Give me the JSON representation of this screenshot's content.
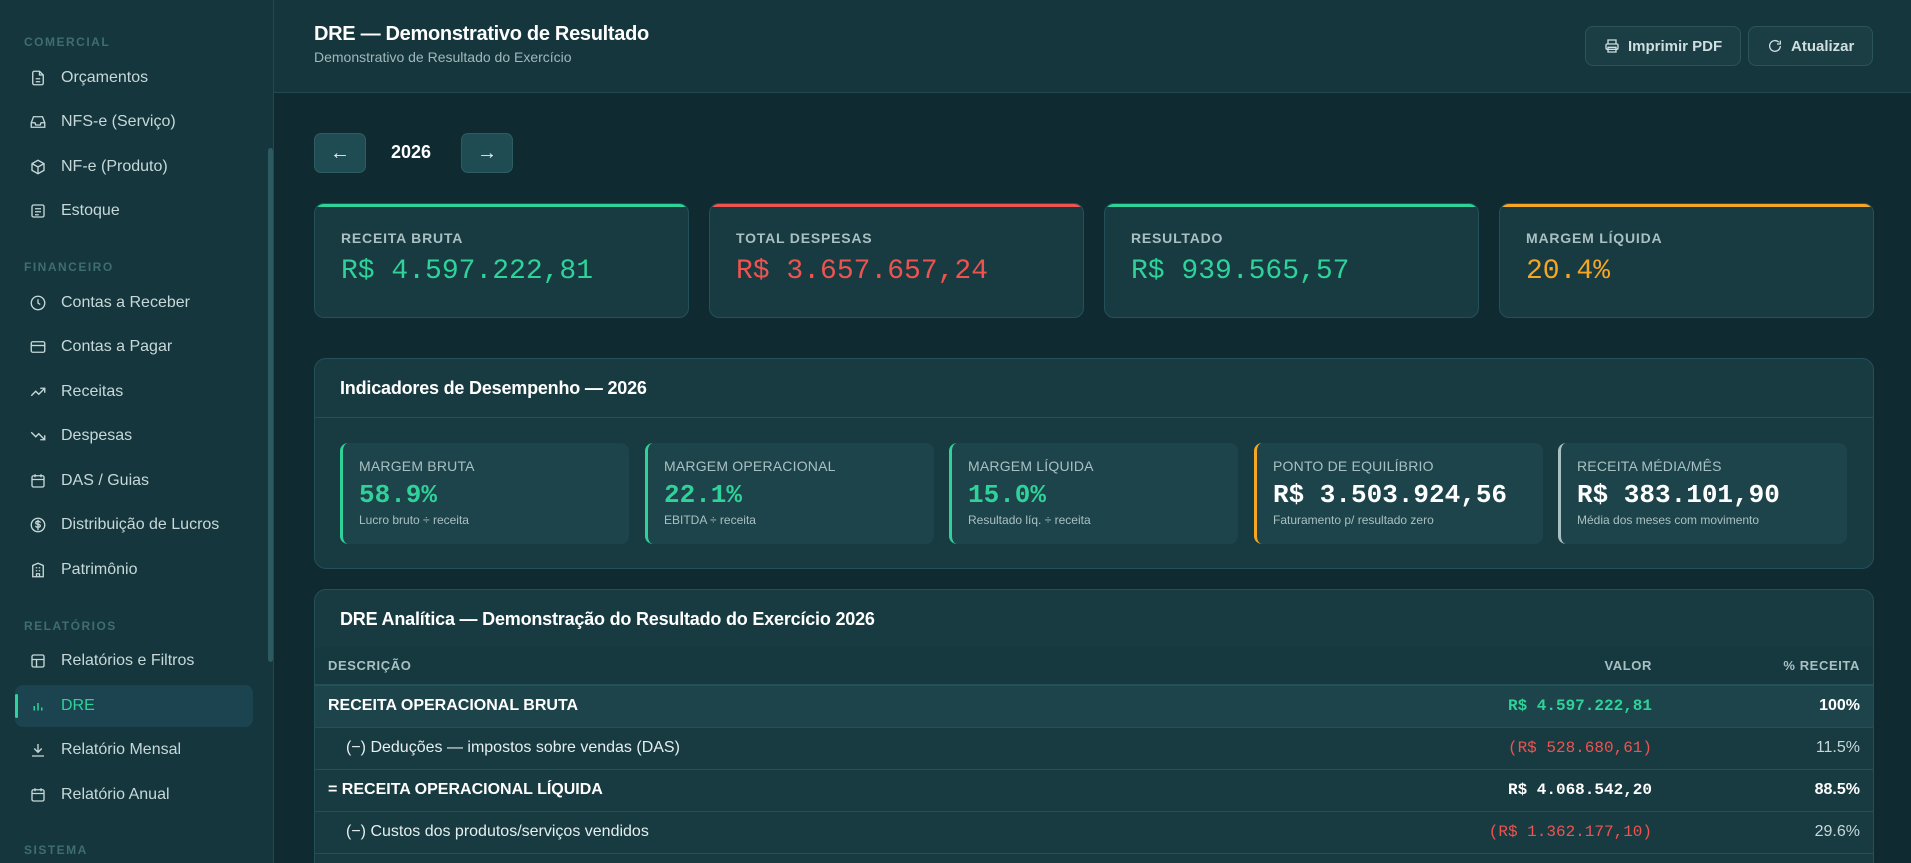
{
  "sidebar": {
    "sections": [
      {
        "label": "COMERCIAL"
      },
      {
        "label": "FINANCEIRO"
      },
      {
        "label": "RELATÓRIOS"
      },
      {
        "label": "SISTEMA"
      }
    ],
    "items": [
      {
        "label": "Orçamentos",
        "icon": "document-icon"
      },
      {
        "label": "NFS-e (Serviço)",
        "icon": "inbox-icon"
      },
      {
        "label": "NF-e (Produto)",
        "icon": "box-icon"
      },
      {
        "label": "Estoque",
        "icon": "list-box-icon"
      },
      {
        "label": "Contas a Receber",
        "icon": "clock-icon"
      },
      {
        "label": "Contas a Pagar",
        "icon": "credit-card-icon"
      },
      {
        "label": "Receitas",
        "icon": "trending-up-icon"
      },
      {
        "label": "Despesas",
        "icon": "trending-down-icon"
      },
      {
        "label": "DAS / Guias",
        "icon": "calendar-icon"
      },
      {
        "label": "Distribuição de Lucros",
        "icon": "dollar-circle-icon"
      },
      {
        "label": "Patrimônio",
        "icon": "building-icon"
      },
      {
        "label": "Relatórios e Filtros",
        "icon": "layout-icon"
      },
      {
        "label": "DRE",
        "icon": "bar-chart-icon",
        "active": true
      },
      {
        "label": "Relatório Mensal",
        "icon": "download-icon"
      },
      {
        "label": "Relatório Anual",
        "icon": "calendar-icon"
      }
    ]
  },
  "header": {
    "title": "DRE — Demonstrativo de Resultado",
    "subtitle": "Demonstrativo de Resultado do Exercício",
    "print_label": "Imprimir PDF",
    "refresh_label": "Atualizar"
  },
  "yearnav": {
    "prev": "←",
    "year": "2026",
    "next": "→"
  },
  "kpis": [
    {
      "label": "RECEITA BRUTA",
      "value": "R$ 4.597.222,81",
      "color": "#2fd39a"
    },
    {
      "label": "TOTAL DESPESAS",
      "value": "R$ 3.657.657,24",
      "color": "#ef5350"
    },
    {
      "label": "RESULTADO",
      "value": "R$ 939.565,57",
      "color": "#2fd39a"
    },
    {
      "label": "MARGEM LÍQUIDA",
      "value": "20.4%",
      "color": "#f5a623"
    }
  ],
  "indicators": {
    "title": "Indicadores de Desempenho — 2026",
    "items": [
      {
        "label": "MARGEM BRUTA",
        "value": "58.9%",
        "note": "Lucro bruto ÷ receita",
        "color": "#2fd39a"
      },
      {
        "label": "MARGEM OPERACIONAL",
        "value": "22.1%",
        "note": "EBITDA ÷ receita",
        "color": "#2fd39a"
      },
      {
        "label": "MARGEM LÍQUIDA",
        "value": "15.0%",
        "note": "Resultado líq. ÷ receita",
        "color": "#2fd39a"
      },
      {
        "label": "PONTO DE EQUILÍBRIO",
        "value": "R$ 3.503.924,56",
        "note": "Faturamento p/ resultado zero",
        "color": "#f5a623"
      },
      {
        "label": "RECEITA MÉDIA/MÊS",
        "value": "R$ 383.101,90",
        "note": "Média dos meses com movimento",
        "color": "#a9c0c3"
      }
    ]
  },
  "dre": {
    "title": "DRE Analítica — Demonstração do Resultado do Exercício 2026",
    "columns": {
      "desc": "DESCRIÇÃO",
      "value": "VALOR",
      "pct": "% RECEITA"
    },
    "rows": [
      {
        "desc": "RECEITA OPERACIONAL BRUTA",
        "value": "R$ 4.597.222,81",
        "pct": "100%"
      },
      {
        "desc": "(−) Deduções — impostos sobre vendas (DAS)",
        "value": "(R$ 528.680,61)",
        "pct": "11.5%"
      },
      {
        "desc": "= RECEITA OPERACIONAL LÍQUIDA",
        "value": "R$ 4.068.542,20",
        "pct": "88.5%"
      },
      {
        "desc": "(−) Custos dos produtos/serviços vendidos",
        "value": "(R$ 1.362.177,10)",
        "pct": "29.6%"
      }
    ]
  }
}
